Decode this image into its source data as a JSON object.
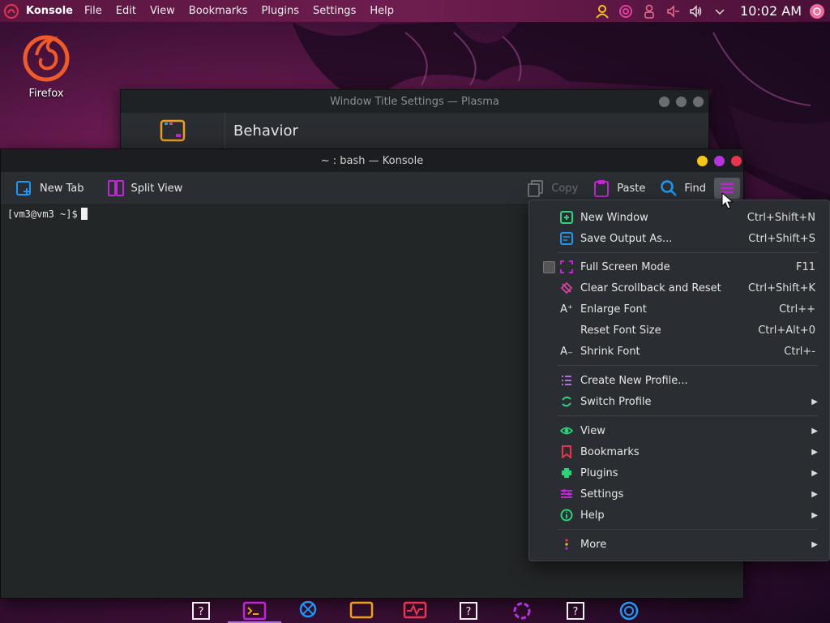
{
  "top_panel": {
    "app_name": "Konsole",
    "menu": [
      "File",
      "Edit",
      "View",
      "Bookmarks",
      "Plugins",
      "Settings",
      "Help"
    ],
    "clock": "10:02 AM",
    "tray_icons": [
      "user-icon",
      "spiral-icon",
      "person-icon",
      "audio-mute-icon",
      "volume-icon",
      "chevron-down-icon"
    ]
  },
  "desktop": {
    "firefox_label": "Firefox"
  },
  "bg_window": {
    "title": "Window Title Settings — Plasma",
    "heading": "Behavior"
  },
  "konsole": {
    "title": "~ : bash — Konsole",
    "toolbar": {
      "new_tab": "New Tab",
      "split_view": "Split View",
      "copy": "Copy",
      "paste": "Paste",
      "find": "Find"
    },
    "prompt": "[vm3@vm3 ~]$"
  },
  "menu": {
    "items": [
      {
        "label": "New Window",
        "shortcut": "Ctrl+Shift+N",
        "icon": "new-window-icon"
      },
      {
        "label": "Save Output As...",
        "shortcut": "Ctrl+Shift+S",
        "icon": "save-icon"
      },
      {
        "label": "Full Screen Mode",
        "shortcut": "F11",
        "icon": "fullscreen-icon"
      },
      {
        "label": "Clear Scrollback and Reset",
        "shortcut": "Ctrl+Shift+K",
        "icon": "clear-icon"
      },
      {
        "label": "Enlarge Font",
        "shortcut": "Ctrl++",
        "icon": "enlarge-font-icon"
      },
      {
        "label": "Reset Font Size",
        "shortcut": "Ctrl+Alt+0",
        "icon": ""
      },
      {
        "label": "Shrink Font",
        "shortcut": "Ctrl+-",
        "icon": "shrink-font-icon"
      },
      {
        "label": "Create New Profile...",
        "shortcut": "",
        "icon": "new-profile-icon"
      },
      {
        "label": "Switch Profile",
        "shortcut": "",
        "icon": "switch-profile-icon"
      },
      {
        "label": "View",
        "shortcut": "",
        "icon": "eye-icon"
      },
      {
        "label": "Bookmarks",
        "shortcut": "",
        "icon": "bookmark-icon"
      },
      {
        "label": "Plugins",
        "shortcut": "",
        "icon": "plugin-icon"
      },
      {
        "label": "Settings",
        "shortcut": "",
        "icon": "settings-icon"
      },
      {
        "label": "Help",
        "shortcut": "",
        "icon": "help-icon"
      },
      {
        "label": "More",
        "shortcut": "",
        "icon": "more-icon"
      }
    ]
  },
  "colors": {
    "accent": "#c026d3",
    "panel_bg": "#5a1640",
    "window_bg": "#232629",
    "menu_bg": "#2a2e32",
    "btn_yellow": "#f5c518",
    "btn_purple": "#b833e0",
    "btn_red": "#e8344e"
  }
}
